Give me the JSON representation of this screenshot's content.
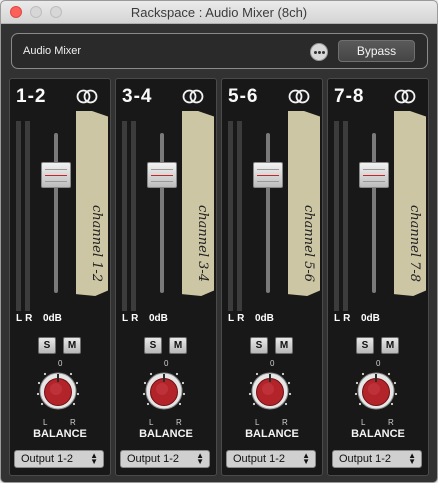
{
  "window": {
    "title": "Rackspace : Audio Mixer (8ch)"
  },
  "header": {
    "title": "Audio Mixer",
    "more_icon": "more-icon",
    "bypass_label": "Bypass"
  },
  "strips": [
    {
      "label": "1-2",
      "tape_label": "channel 1-2",
      "meter_l": "L",
      "meter_r": "R",
      "level": "0dB",
      "fader_level_pct": 78,
      "solo": "S",
      "mute": "M",
      "knob_center": "0",
      "knob_left": "L",
      "knob_right": "R",
      "balance_label": "BALANCE",
      "output": "Output 1-2"
    },
    {
      "label": "3-4",
      "tape_label": "channel 3-4",
      "meter_l": "L",
      "meter_r": "R",
      "level": "0dB",
      "fader_level_pct": 78,
      "solo": "S",
      "mute": "M",
      "knob_center": "0",
      "knob_left": "L",
      "knob_right": "R",
      "balance_label": "BALANCE",
      "output": "Output 1-2"
    },
    {
      "label": "5-6",
      "tape_label": "channel 5-6",
      "meter_l": "L",
      "meter_r": "R",
      "level": "0dB",
      "fader_level_pct": 78,
      "solo": "S",
      "mute": "M",
      "knob_center": "0",
      "knob_left": "L",
      "knob_right": "R",
      "balance_label": "BALANCE",
      "output": "Output 1-2"
    },
    {
      "label": "7-8",
      "tape_label": "channel 7-8",
      "meter_l": "L",
      "meter_r": "R",
      "level": "0dB",
      "fader_level_pct": 78,
      "solo": "S",
      "mute": "M",
      "knob_center": "0",
      "knob_left": "L",
      "knob_right": "R",
      "balance_label": "BALANCE",
      "output": "Output 1-2"
    }
  ],
  "colors": {
    "knob_red": "#b3232a",
    "tape": "#cdc6a4",
    "meter": "#3c3c3c"
  }
}
